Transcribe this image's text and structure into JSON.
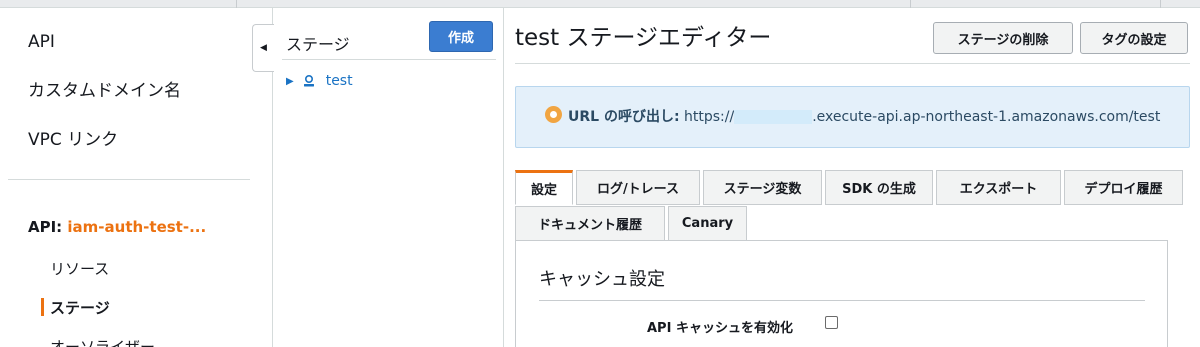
{
  "nav": {
    "top_items": [
      "API",
      "カスタムドメイン名",
      "VPC リンク"
    ],
    "api_prefix": "API: ",
    "api_name": "iam-auth-test-...",
    "sub_items": [
      "リソース",
      "ステージ",
      "オーソライザー"
    ],
    "collapse_icon": "◀"
  },
  "stages": {
    "header": "ステージ",
    "create_label": "作成",
    "caret": "▶",
    "items": [
      "test"
    ]
  },
  "main": {
    "title": "test ステージエディター",
    "delete_label": "ステージの削除",
    "tags_label": "タグの設定"
  },
  "info": {
    "label": "URL の呼び出し:",
    "url_prefix": "https://",
    "url_suffix": ".execute-api.ap-northeast-1.amazonaws.com/test"
  },
  "tabs": {
    "row1": [
      "設定",
      "ログ/トレース",
      "ステージ変数",
      "SDK の生成",
      "エクスポート",
      "デプロイ履歴"
    ],
    "row2": [
      "ドキュメント履歴",
      "Canary"
    ],
    "active": "設定"
  },
  "cache": {
    "title": "キャッシュ設定",
    "enable_label": "API キャッシュを有効化",
    "enabled": false
  },
  "colors": {
    "accent": "#ec7211",
    "primary_button": "#3b7dd1",
    "link": "#1a73c4",
    "info_bg": "#e4f0fa"
  }
}
